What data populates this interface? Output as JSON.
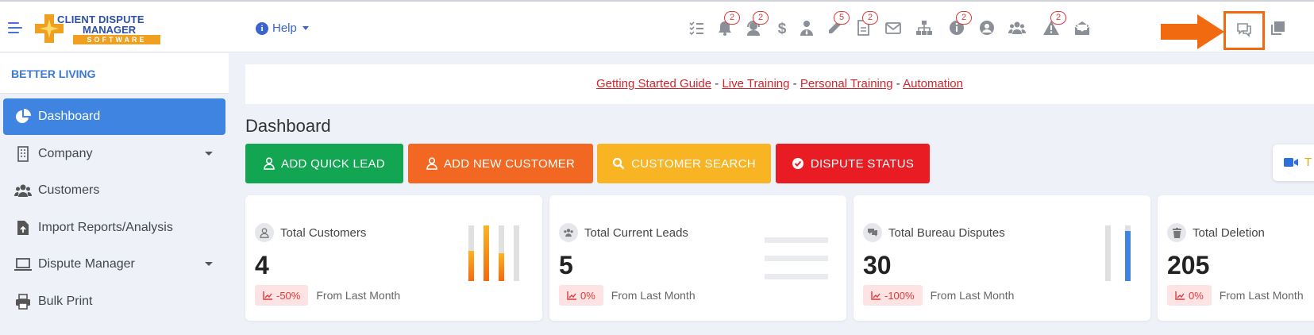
{
  "app": {
    "logo_line1": "CLIENT DISPUTE",
    "logo_line2": "MANAGER",
    "logo_line3": "SOFTWARE"
  },
  "header": {
    "help_label": "Help",
    "badges": {
      "notifications": "2",
      "support": "2",
      "edit": "5",
      "documents": "2",
      "info": "2",
      "warnings": "2"
    }
  },
  "sidebar": {
    "org_name": "BETTER LIVING",
    "items": [
      {
        "label": "Dashboard"
      },
      {
        "label": "Company"
      },
      {
        "label": "Customers"
      },
      {
        "label": "Import Reports/Analysis"
      },
      {
        "label": "Dispute Manager"
      },
      {
        "label": "Bulk Print"
      }
    ]
  },
  "notice": {
    "link1": "Getting Started Guide",
    "sep": "-",
    "link2": "Live Training",
    "link3": "Personal Training",
    "link4": "Automation"
  },
  "main": {
    "title": "Dashboard",
    "actions": {
      "add_quick_lead": "ADD QUICK LEAD",
      "add_new_customer": "ADD NEW CUSTOMER",
      "customer_search": "CUSTOMER SEARCH",
      "dispute_status": "DISPUTE STATUS"
    },
    "side_pill_text": "T",
    "cards": [
      {
        "title": "Total Customers",
        "value": "4",
        "change": "-50%",
        "note": "From Last Month"
      },
      {
        "title": "Total Current Leads",
        "value": "5",
        "change": "0%",
        "note": "From Last Month"
      },
      {
        "title": "Total Bureau Disputes",
        "value": "30",
        "change": "-100%",
        "note": "From Last Month"
      },
      {
        "title": "Total Deletion",
        "value": "205",
        "change": "0%",
        "note": "From Last Month"
      }
    ],
    "card1_bar_levels": [
      0.55,
      1.0,
      0.5,
      0
    ],
    "card3_bar_levels": [
      0,
      0.9
    ]
  },
  "colors": {
    "accent": "#3f84e0",
    "green": "#12a653",
    "orange": "#f26822",
    "yellow": "#f9b424",
    "red": "#ea1c23",
    "highlight": "#f26a10"
  }
}
